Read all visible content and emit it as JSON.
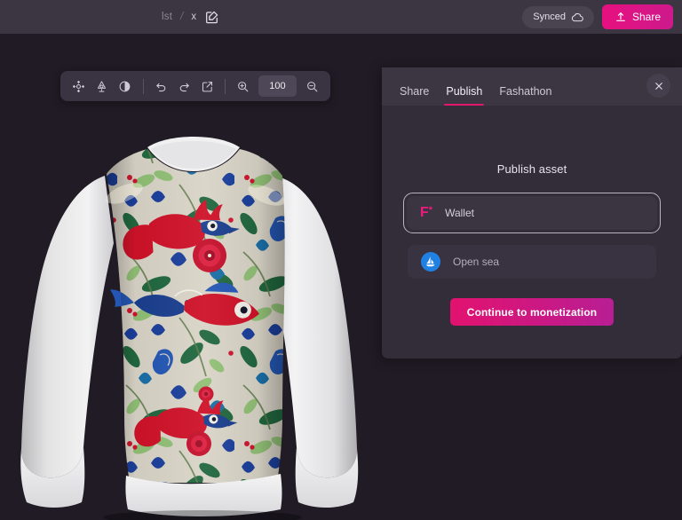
{
  "topbar": {
    "breadcrumb": {
      "parent": "lst",
      "separator": "/",
      "name": "x",
      "edit_icon": "edit-square-icon"
    },
    "sync_status": {
      "label": "Synced",
      "icon": "cloud-icon"
    },
    "share_button": {
      "label": "Share",
      "icon": "upload-icon",
      "color": "#e8107f"
    }
  },
  "toolbar": {
    "buttons": [
      {
        "name": "move-tool",
        "icon": "move-crosshair-icon"
      },
      {
        "name": "lighting-tool",
        "icon": "lamp-icon"
      },
      {
        "name": "contrast-tool",
        "icon": "contrast-half-circle-icon"
      },
      {
        "name": "undo",
        "icon": "undo-arrow-icon"
      },
      {
        "name": "redo",
        "icon": "redo-arrow-icon"
      },
      {
        "name": "open-external",
        "icon": "external-link-icon"
      },
      {
        "name": "zoom-in",
        "icon": "magnifier-plus-icon"
      },
      {
        "name": "zoom-out",
        "icon": "magnifier-minus-icon"
      }
    ],
    "zoom_value": "100"
  },
  "panel": {
    "tabs": [
      {
        "label": "Share",
        "active": false
      },
      {
        "label": "Publish",
        "active": true
      },
      {
        "label": "Fashathon",
        "active": false
      }
    ],
    "close_icon": "close-x-icon",
    "title": "Publish asset",
    "options": [
      {
        "label": "Wallet",
        "icon": "fabricant-f-logo",
        "selected": true
      },
      {
        "label": "Open sea",
        "icon": "opensea-sailboat-icon",
        "selected": false
      }
    ],
    "cta_label": "Continue to monetization",
    "accent_color": "#e2186f"
  },
  "viewport": {
    "background": "#201b24",
    "asset_name": "embroidered-bird-fish-sweatshirt",
    "sleeve_color": "#e9e9ea",
    "body_base_color": "#d8d3c6"
  }
}
